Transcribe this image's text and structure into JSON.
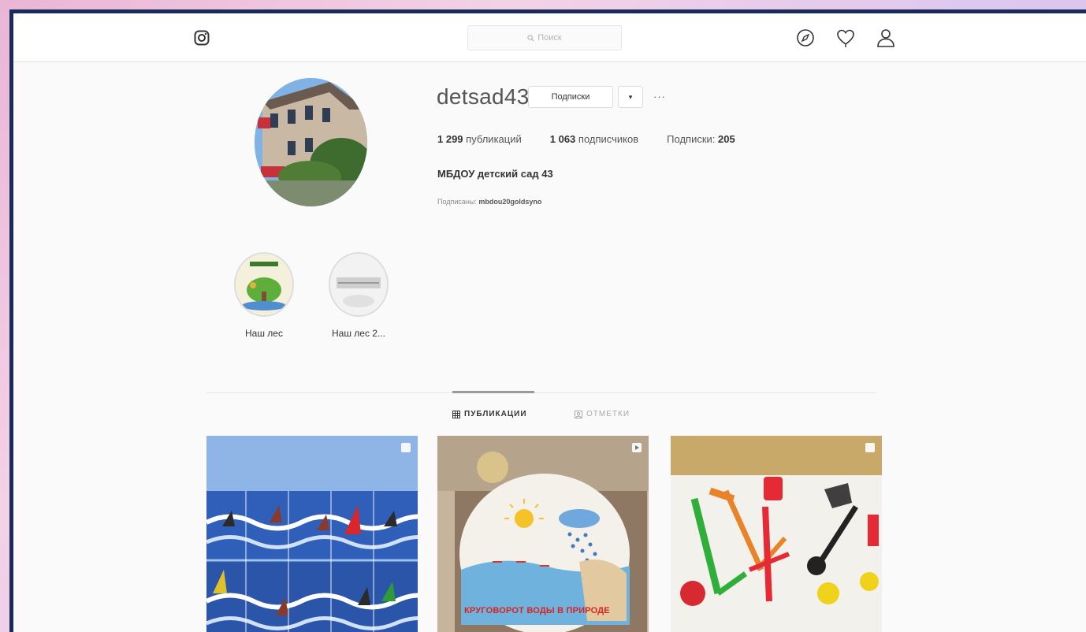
{
  "header": {
    "search_placeholder": "Поиск",
    "icons": [
      "instagram-icon",
      "explore-icon",
      "heart-icon",
      "user-icon"
    ]
  },
  "profile": {
    "username": "detsad43",
    "follow_label": "Подписки",
    "dropdown_label": "▾",
    "more_label": "···",
    "posts_count": "1 299",
    "posts_label": "публикаций",
    "followers_count": "1 063",
    "followers_label": "подписчиков",
    "following_label": "Подписки:",
    "following_count": "205",
    "full_name": "МБДОУ детский сад 43",
    "followed_by_prefix": "Подписаны:",
    "followed_by_account": "mbdou20goldsyno"
  },
  "highlights": [
    {
      "label": "Наш лес"
    },
    {
      "label": "Наш лес 2..."
    }
  ],
  "tabs": [
    {
      "label": "ПУБЛИКАЦИИ",
      "active": true
    },
    {
      "label": "ОТМЕТКИ",
      "active": false
    }
  ],
  "posts": [
    {
      "badge": "multi-image-icon"
    },
    {
      "badge": "video-icon",
      "caption": "КРУГОВОРОТ ВОДЫ В ПРИРОДЕ"
    },
    {
      "badge": "multi-image-icon"
    }
  ],
  "colors": {
    "frame": "#1b2a5c",
    "accent": "#d9231f",
    "background": "#fafafa"
  }
}
